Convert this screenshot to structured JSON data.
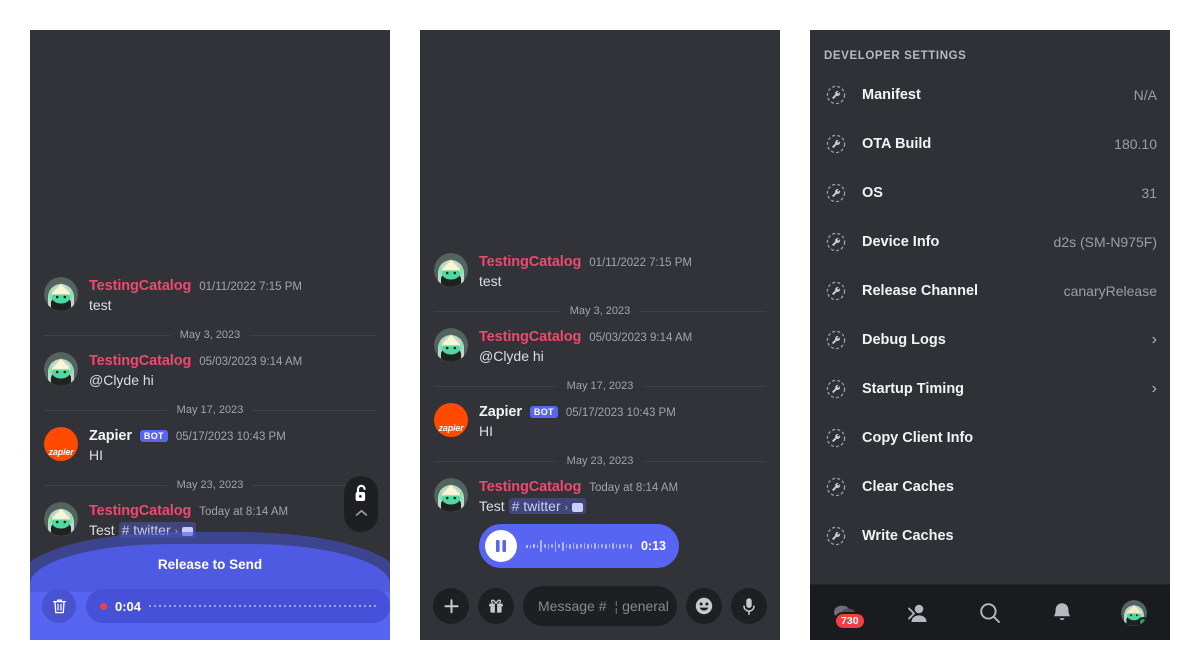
{
  "panels": {
    "chat_recording": {
      "name": "Discord chat with voice recording in progress",
      "messages": [
        {
          "author": "TestingCatalog",
          "is_bot": false,
          "timestamp": "01/11/2022 7:15 PM",
          "text": "test",
          "avatar": "testingcatalog-avatar"
        },
        {
          "divider": "May 3, 2023"
        },
        {
          "author": "TestingCatalog",
          "is_bot": false,
          "timestamp": "05/03/2023 9:14 AM",
          "text": "@Clyde hi",
          "avatar": "testingcatalog-avatar"
        },
        {
          "divider": "May 17, 2023"
        },
        {
          "author": "Zapier",
          "is_bot": true,
          "bot_tag": "BOT",
          "timestamp": "05/17/2023 10:43 PM",
          "text": "HI",
          "avatar": "zapier-avatar"
        },
        {
          "divider": "May 23, 2023"
        },
        {
          "author": "TestingCatalog",
          "is_bot": false,
          "timestamp": "Today at 8:14 AM",
          "text_prefix": "Test",
          "mention": "twitter",
          "avatar": "testingcatalog-avatar"
        }
      ],
      "recording": {
        "title": "Release to Send",
        "elapsed": "0:04",
        "trash_icon": "trash-icon",
        "send_icon": "send-icon",
        "lock_icon": "unlock-icon",
        "chevron_icon": "chevron-up-icon",
        "accent": "#5865f2",
        "record_dot_color": "#f23f43"
      }
    },
    "chat_voice": {
      "name": "Discord chat with sent voice message",
      "messages": [
        {
          "author": "TestingCatalog",
          "is_bot": false,
          "timestamp": "01/11/2022 7:15 PM",
          "text": "test",
          "avatar": "testingcatalog-avatar"
        },
        {
          "divider": "May 3, 2023"
        },
        {
          "author": "TestingCatalog",
          "is_bot": false,
          "timestamp": "05/03/2023 9:14 AM",
          "text": "@Clyde hi",
          "avatar": "testingcatalog-avatar"
        },
        {
          "divider": "May 17, 2023"
        },
        {
          "author": "Zapier",
          "is_bot": true,
          "bot_tag": "BOT",
          "timestamp": "05/17/2023 10:43 PM",
          "text": "HI",
          "avatar": "zapier-avatar"
        },
        {
          "divider": "May 23, 2023"
        },
        {
          "author": "TestingCatalog",
          "is_bot": false,
          "timestamp": "Today at 8:14 AM",
          "text_prefix": "Test",
          "mention": "twitter",
          "avatar": "testingcatalog-avatar",
          "voice_message": {
            "duration": "0:13",
            "state": "playing",
            "button_icon": "pause-icon"
          }
        }
      ],
      "input_bar": {
        "add_icon": "plus-icon",
        "gift_icon": "gift-icon",
        "placeholder_prefix": "Message #",
        "placeholder_channel": "general",
        "emoji_icon": "emoji-icon",
        "mic_icon": "microphone-icon"
      }
    },
    "dev_settings": {
      "header": "DEVELOPER SETTINGS",
      "rows": [
        {
          "icon": "wrench-icon",
          "label": "Manifest",
          "value": "N/A"
        },
        {
          "icon": "wrench-icon",
          "label": "OTA Build",
          "value": "180.10"
        },
        {
          "icon": "wrench-icon",
          "label": "OS",
          "value": "31"
        },
        {
          "icon": "wrench-icon",
          "label": "Device Info",
          "value": "d2s (SM-N975F)"
        },
        {
          "icon": "wrench-icon",
          "label": "Release Channel",
          "value": "canaryRelease"
        },
        {
          "icon": "wrench-icon",
          "label": "Debug Logs",
          "value": "",
          "chevron": "›"
        },
        {
          "icon": "wrench-icon",
          "label": "Startup Timing",
          "value": "",
          "chevron": "›"
        },
        {
          "icon": "wrench-icon",
          "label": "Copy Client Info",
          "value": ""
        },
        {
          "icon": "wrench-icon",
          "label": "Clear Caches",
          "value": ""
        },
        {
          "icon": "wrench-icon",
          "label": "Write Caches",
          "value": ""
        }
      ],
      "navbar": {
        "items": [
          {
            "icon": "servers-icon",
            "badge": "730"
          },
          {
            "icon": "friends-icon",
            "badge": ""
          },
          {
            "icon": "search-icon",
            "badge": ""
          },
          {
            "icon": "notifications-icon",
            "badge": ""
          },
          {
            "icon": "profile-avatar-icon",
            "badge": ""
          }
        ]
      }
    }
  },
  "colors": {
    "panel_bg": "#313338",
    "settings_bg": "#2f3136",
    "accent_blurple": "#5865f2",
    "username_red": "#ed4a6d",
    "badge_red": "#f23f43",
    "zapier_orange": "#ff4a00",
    "online_green": "#23a55a"
  }
}
